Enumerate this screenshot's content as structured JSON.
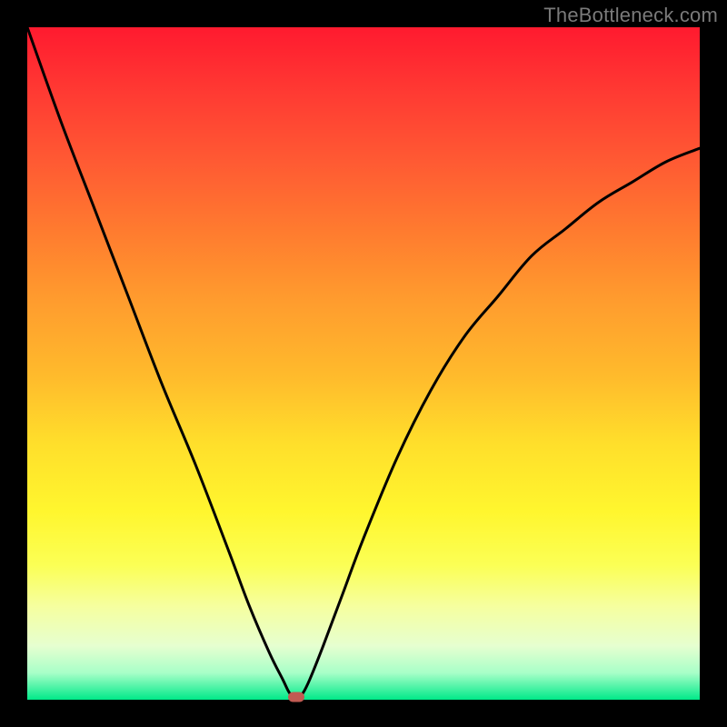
{
  "watermark": "TheBottleneck.com",
  "colors": {
    "frame": "#000000",
    "curve": "#000000",
    "marker": "#c15a52"
  },
  "chart_data": {
    "type": "line",
    "title": "",
    "xlabel": "",
    "ylabel": "",
    "xlim": [
      0,
      100
    ],
    "ylim": [
      0,
      100
    ],
    "grid": false,
    "axes_visible": false,
    "series": [
      {
        "name": "bottleneck-curve",
        "x": [
          0,
          5,
          10,
          15,
          20,
          25,
          30,
          33,
          36,
          38,
          39,
          40,
          41,
          42,
          44,
          47,
          50,
          55,
          60,
          65,
          70,
          75,
          80,
          85,
          90,
          95,
          100
        ],
        "values": [
          100,
          86,
          73,
          60,
          47,
          35,
          22,
          14,
          7,
          3,
          1,
          0,
          1,
          3,
          8,
          16,
          24,
          36,
          46,
          54,
          60,
          66,
          70,
          74,
          77,
          80,
          82
        ]
      }
    ],
    "annotations": [
      {
        "name": "optimal-point",
        "x": 40,
        "y": 0
      }
    ],
    "gradient_stops": [
      {
        "pos": 0,
        "color": "#ff1a2f"
      },
      {
        "pos": 50,
        "color": "#ffbb2c"
      },
      {
        "pos": 75,
        "color": "#fff62e"
      },
      {
        "pos": 100,
        "color": "#00e989"
      }
    ]
  }
}
